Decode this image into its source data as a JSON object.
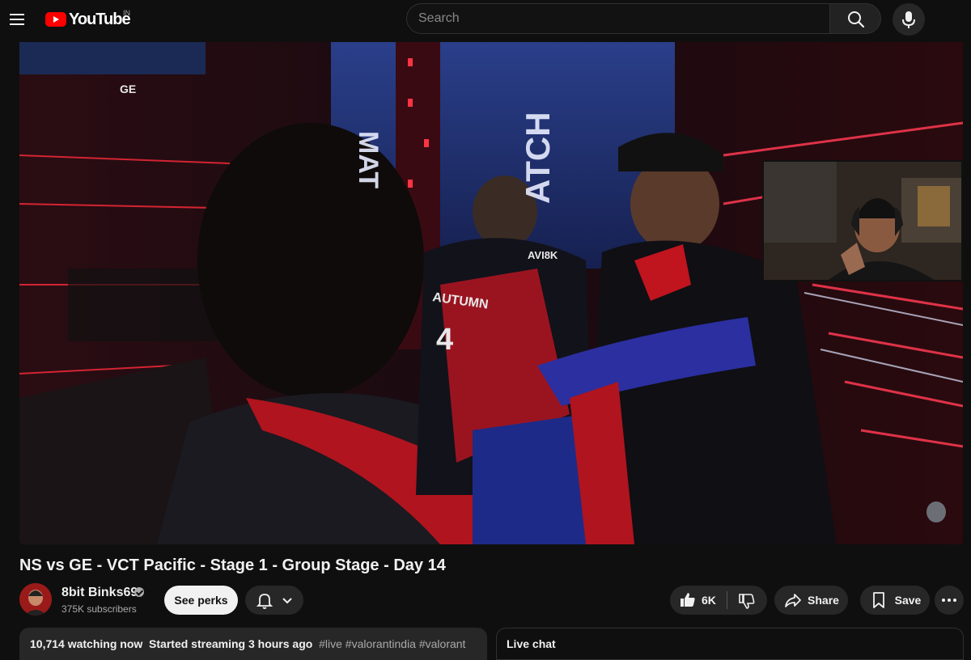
{
  "header": {
    "logo_text": "YouTube",
    "country_code": "IN",
    "search_placeholder": "Search"
  },
  "video": {
    "title": "NS vs GE - VCT Pacific - Stage 1 - Group Stage - Day 14",
    "overlay_text": "GE"
  },
  "channel": {
    "name": "8bit Binks69",
    "subscribers": "375K subscribers",
    "perks_label": "See perks"
  },
  "actions": {
    "likes": "6K",
    "share_label": "Share",
    "save_label": "Save"
  },
  "description": {
    "watching": "10,714 watching now",
    "started": "Started streaming 3 hours ago",
    "hashtags": "#live #valorantindia #valorant"
  },
  "chat": {
    "title": "Live chat"
  },
  "colors": {
    "background": "#0f0f0f",
    "brand_red": "#ff0000",
    "chip": "#272727",
    "text_secondary": "#aaaaaa"
  },
  "icons": [
    "menu-icon",
    "youtube-logo-icon",
    "search-icon",
    "mic-icon",
    "verified-icon",
    "bell-icon",
    "chevron-down-icon",
    "thumbs-up-icon",
    "thumbs-down-icon",
    "share-icon",
    "save-icon",
    "more-icon"
  ]
}
